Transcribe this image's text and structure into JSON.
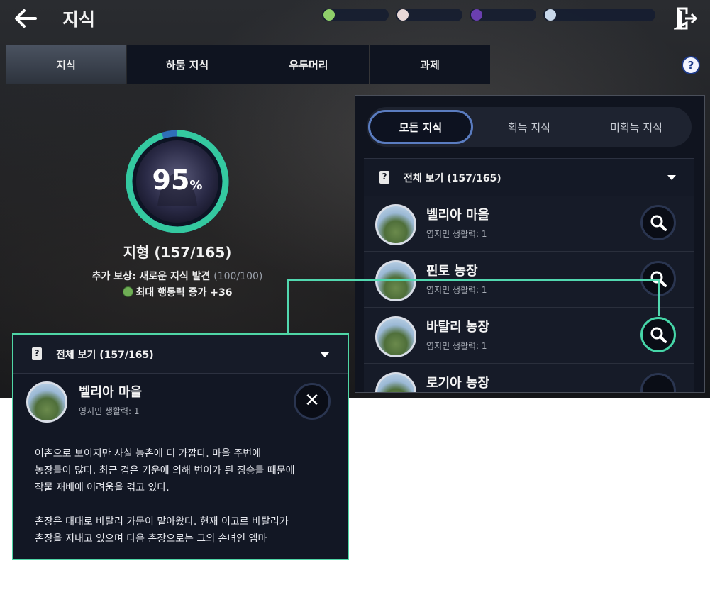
{
  "header": {
    "title": "지식",
    "back_icon": "arrow-left-icon",
    "exit_icon": "exit-door-icon"
  },
  "resources": [
    {
      "icon": "energy-gem-icon",
      "color": "#8fcf6a"
    },
    {
      "icon": "pearl-icon",
      "color": "#e8d8d8"
    },
    {
      "icon": "dark-orb-icon",
      "color": "#6a3fb0"
    },
    {
      "icon": "silver-coin-icon",
      "color": "#c8d8ea"
    }
  ],
  "tabs": [
    {
      "label": "지식",
      "active": true
    },
    {
      "label": "하둠 지식",
      "active": false
    },
    {
      "label": "우두머리",
      "active": false
    },
    {
      "label": "과제",
      "active": false
    }
  ],
  "help_label": "?",
  "progress": {
    "percent": 95,
    "percent_text": "95",
    "unit": "%",
    "category": "지형 (157/165)",
    "reward": "추가 보상: 새로운 지식 발견",
    "reward_count": "(100/100)",
    "bonus": "최대 행동력 증가 +36"
  },
  "filters": [
    {
      "label": "모든 지식",
      "active": true
    },
    {
      "label": "획득 지식",
      "active": false
    },
    {
      "label": "미획득 지식",
      "active": false
    }
  ],
  "list": {
    "header": "전체 보기 (157/165)",
    "header_icon_text": "?",
    "items": [
      {
        "name": "벨리아 마을",
        "sub": "영지민 생활력: 1",
        "selected": false
      },
      {
        "name": "핀토 농장",
        "sub": "영지민 생활력: 1",
        "selected": false
      },
      {
        "name": "바탈리 농장",
        "sub": "영지민 생활력: 1",
        "selected": true
      },
      {
        "name": "로기아 농장",
        "sub": "",
        "selected": false
      }
    ]
  },
  "detail": {
    "header": "전체 보기 (157/165)",
    "header_icon_text": "?",
    "name": "벨리아 마을",
    "sub": "영지민 생활력: 1",
    "close_label": "✕",
    "description": "어촌으로 보이지만 사실 농촌에 더 가깝다. 마을 주변에\n농장들이 많다. 최근 검은 기운에 의해 변이가 된 짐승들 때문에\n작물 재배에 어려움을 겪고 있다.\n\n촌장은 대대로 바탈리 가문이 맡아왔다. 현재 이고르 바탈리가\n촌장을 지내고 있으며 다음 촌장으로는 그의 손녀인 엠마"
  },
  "colors": {
    "ring_progress": "#34c9a0",
    "ring_remaining": "#2f6fb8",
    "highlight": "#4fd6a6"
  }
}
